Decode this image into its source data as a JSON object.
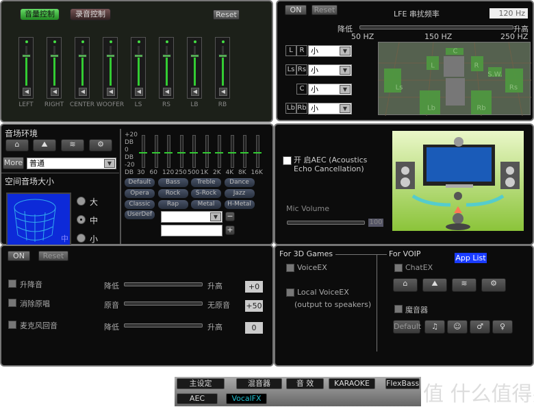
{
  "mixer": {
    "tab_volume": "音量控制",
    "tab_record": "录音控制",
    "reset": "Reset",
    "channels": [
      {
        "label": "LEFT",
        "level": 75
      },
      {
        "label": "RIGHT",
        "level": 75
      },
      {
        "label": "CENTER",
        "level": 75
      },
      {
        "label": "WOOFER",
        "level": 75
      },
      {
        "label": "LS",
        "level": 75
      },
      {
        "label": "RS",
        "level": 75
      },
      {
        "label": "LB",
        "level": 75
      },
      {
        "label": "RB",
        "level": 75
      }
    ]
  },
  "speakers": {
    "on": "ON",
    "reset": "Reset",
    "lfe_title": "LFE 串扰频率",
    "lfe_value": "120 Hz",
    "lower": "降低",
    "higher": "升高",
    "ticks": [
      "50 HZ",
      "150 HZ",
      "250 HZ"
    ],
    "rows": [
      {
        "a": "L",
        "b": "R",
        "size": "小"
      },
      {
        "a": "Ls",
        "b": "Rs",
        "size": "小"
      },
      {
        "a": "",
        "b": "C",
        "size": "小"
      },
      {
        "a": "Lb",
        "b": "Rb",
        "size": "小"
      }
    ],
    "diagram_labels": [
      "C",
      "L",
      "R",
      "S.W.",
      "Ls",
      "Rs",
      "Lb",
      "Rb"
    ]
  },
  "environment": {
    "title": "音场环境",
    "more": "More",
    "preset": "普通",
    "room_title": "空间音场大小",
    "room_badge": "中",
    "sizes": [
      "大",
      "中",
      "小"
    ],
    "selected_size": "中"
  },
  "eq": {
    "db_labels": [
      "+20",
      "DB",
      "0",
      "DB",
      "-20",
      "DB"
    ],
    "bands": [
      "30",
      "60",
      "120",
      "250",
      "500",
      "1K",
      "2K",
      "4K",
      "8K",
      "16K"
    ],
    "band_values_db": [
      0,
      0,
      0,
      0,
      0,
      0,
      0,
      0,
      0,
      0
    ],
    "presets": [
      "Default",
      "Bass",
      "Treble",
      "Dance",
      "Opera",
      "Rock",
      "S-Rock",
      "Jazz",
      "Classic",
      "Rap",
      "Metal",
      "H-Metal"
    ],
    "userdef": "UserDef",
    "user_select": "",
    "user_name": "",
    "minus": "−",
    "plus": "+"
  },
  "aec": {
    "label": "开 启AEC (Acoustics Echo Cancellation)",
    "checked": false,
    "mic_label": "Mic Volume",
    "mic_value": "100"
  },
  "vocal": {
    "on": "ON",
    "reset": "Reset",
    "rows": [
      {
        "label": "升降音",
        "low": "降低",
        "high": "升高",
        "value": "+0"
      },
      {
        "label": "消除原唱",
        "low": "原音",
        "high": "无原音",
        "value": "+50"
      },
      {
        "label": "麦克风回音",
        "low": "降低",
        "high": "升高",
        "value": "0"
      }
    ]
  },
  "voice": {
    "games_title": "For 3D Games",
    "voiceex": "VoiceEX",
    "local_voiceex": "Local VoiceEX",
    "local_note": "(output to speakers)",
    "voip_title": "For VOIP",
    "app_list": "App List",
    "chatex": "ChatEX",
    "morph": "魔音器",
    "morph_default": "Default",
    "morph_icons": [
      "♫",
      "☺",
      "♂",
      "♀"
    ]
  },
  "tabs": [
    "主设定",
    "混音器",
    "音 效",
    "KARAOKE",
    "FlexBass",
    "AEC",
    "VocalFX"
  ],
  "active_tab": "VocalFX",
  "watermark": "值 什么值得买",
  "colors": {
    "accent_green": "#33cc33",
    "active_tab": "#22c0d0",
    "app_list": "#1a3cff"
  }
}
